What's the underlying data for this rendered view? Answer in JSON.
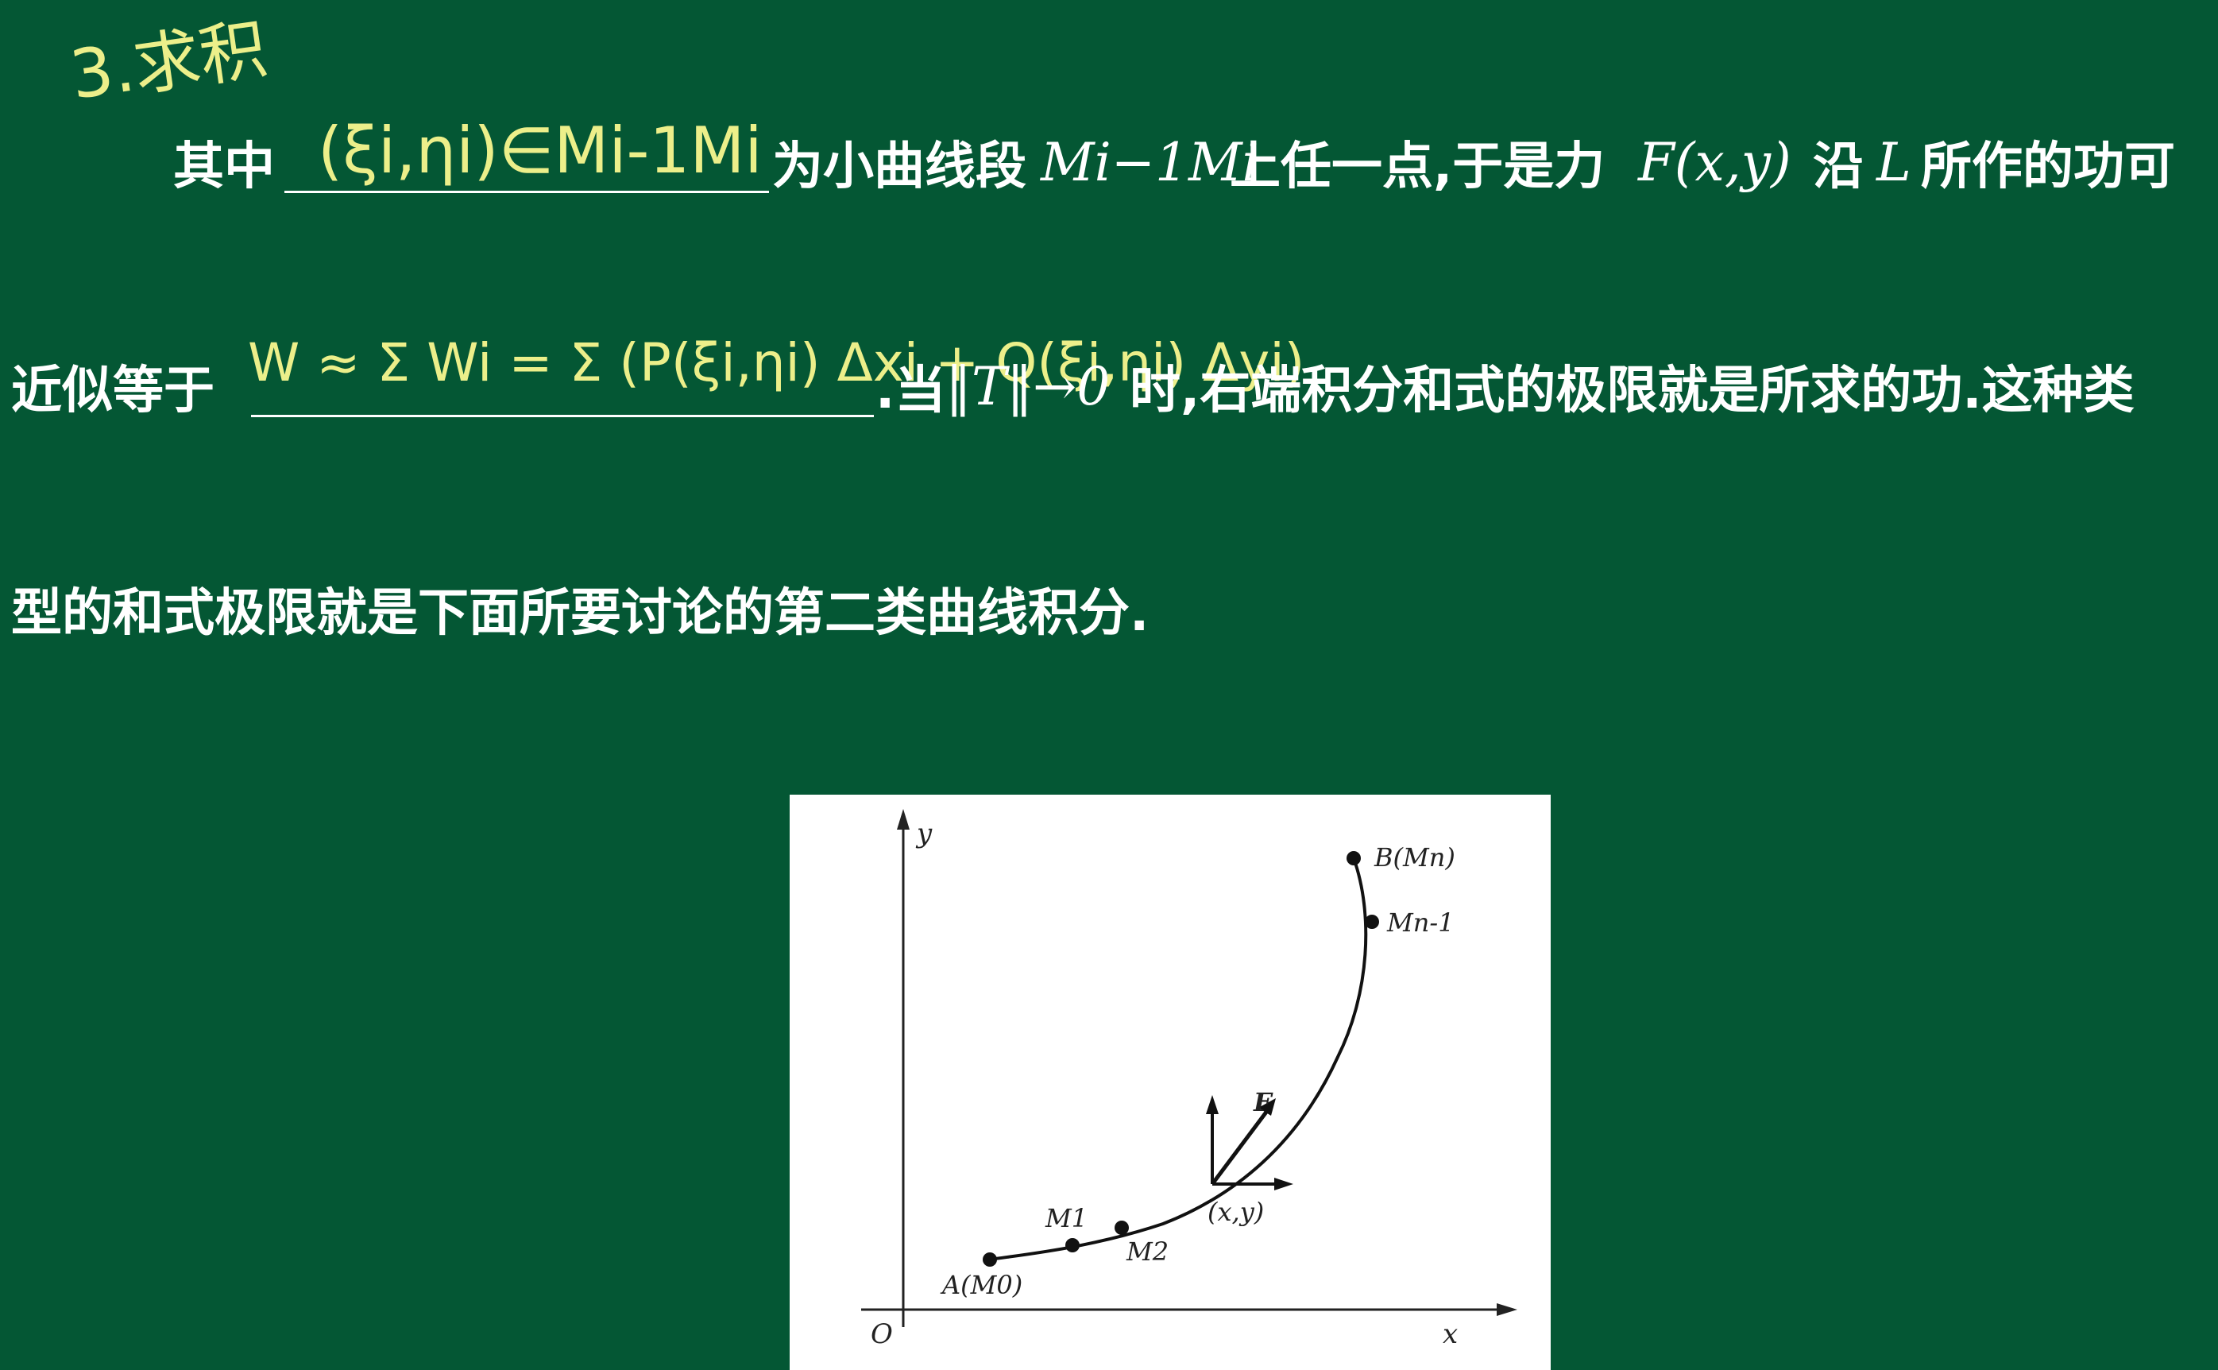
{
  "annotation": {
    "corner_note": "3.求积"
  },
  "line1": {
    "prefix": "其中",
    "blank_handwritten": "(ξi,ηi)∈Mi-1Mi",
    "text_a": "为小曲线段",
    "math_a": "Mi−1Mi",
    "text_b": "上任一点,于是力",
    "math_b": "F(x,y)",
    "text_c": "沿",
    "math_c": "L",
    "text_d": "所作的功可"
  },
  "line2": {
    "prefix": "近似等于",
    "blank_handwritten": "W ≈ Σ Wi = Σ (P(ξi,ηi) Δxi + Q(ξi,ηi) Δyi)",
    "text_a": ".当",
    "math_a": "‖T‖→0",
    "text_b": "时,右端积分和式的极限就是所求的功.这种类"
  },
  "line3": {
    "text": "型的和式极限就是下面所要讨论的第二类曲线积分."
  },
  "figure": {
    "label_y": "y",
    "label_x": "x",
    "label_o": "O",
    "label_b": "B(Mn)",
    "label_mn1": "Mn-1",
    "label_f": "F",
    "label_xy": "(x,y)",
    "label_m1": "M1",
    "label_m2": "M2",
    "label_a": "A(M0)"
  }
}
